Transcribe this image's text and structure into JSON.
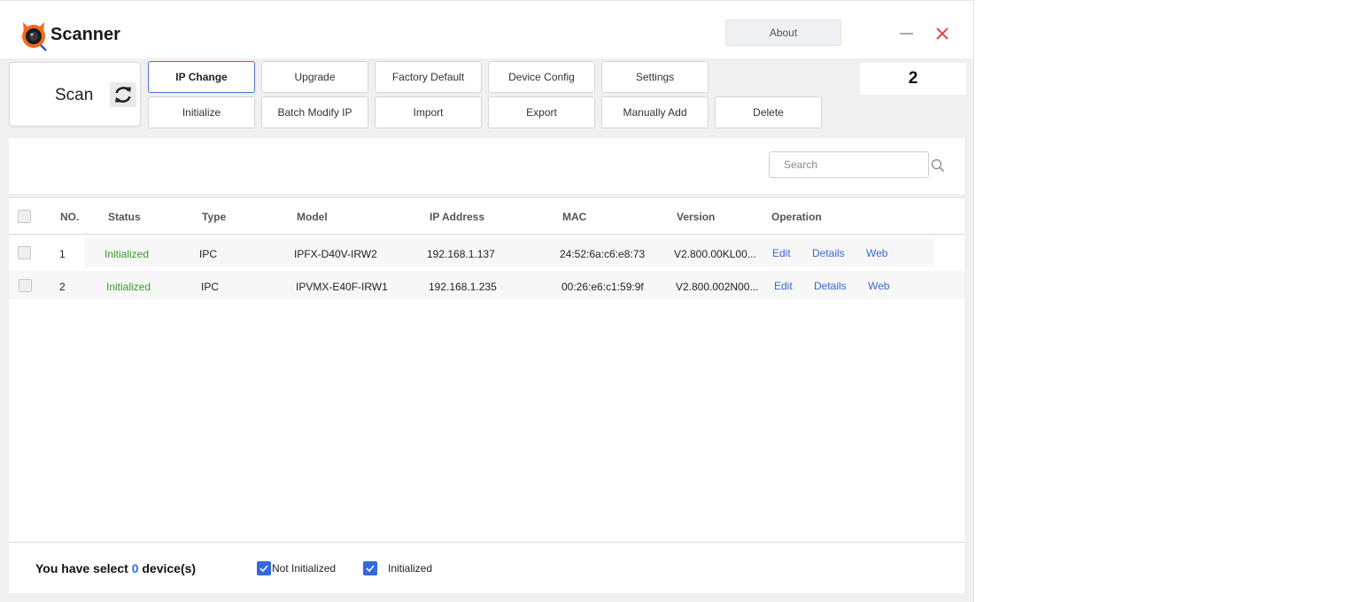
{
  "app": {
    "title": "Scanner"
  },
  "titlebar": {
    "about_label": "About"
  },
  "toolbar": {
    "scan_label": "Scan",
    "row1": [
      "IP Change",
      "Upgrade",
      "Factory Default",
      "Device Config",
      "Settings"
    ],
    "row2": [
      "Initialize",
      "Batch Modify IP",
      "Import",
      "Export",
      "Manually Add",
      "Delete"
    ],
    "device_count": "2"
  },
  "search": {
    "placeholder": "Search"
  },
  "table": {
    "headers": [
      "NO.",
      "Status",
      "Type",
      "Model",
      "IP Address",
      "MAC",
      "Version",
      "Operation"
    ],
    "rows": [
      {
        "no": "1",
        "status": "Initialized",
        "type": "IPC",
        "model": "IPFX-D40V-IRW2",
        "ip": "192.168.1.137",
        "mac": "24:52:6a:c6:e8:73",
        "version": "V2.800.00KL00...",
        "ops": [
          "Edit",
          "Details",
          "Web"
        ]
      },
      {
        "no": "2",
        "status": "Initialized",
        "type": "IPC",
        "model": "IPVMX-E40F-IRW1",
        "ip": "192.168.1.235",
        "mac": "00:26:e6:c1:59:9f",
        "version": "V2.800.002N00...",
        "ops": [
          "Edit",
          "Details",
          "Web"
        ]
      }
    ]
  },
  "footer": {
    "selected_prefix": "You have select ",
    "selected_count": "0",
    "selected_suffix": " device(s)",
    "filter_not_initialized": "Not Initialized",
    "filter_initialized": "Initialized"
  },
  "colors": {
    "accent": "#3269e0",
    "status_ok": "#3a9a2a",
    "link": "#3a67d0",
    "close": "#e04a4a"
  }
}
